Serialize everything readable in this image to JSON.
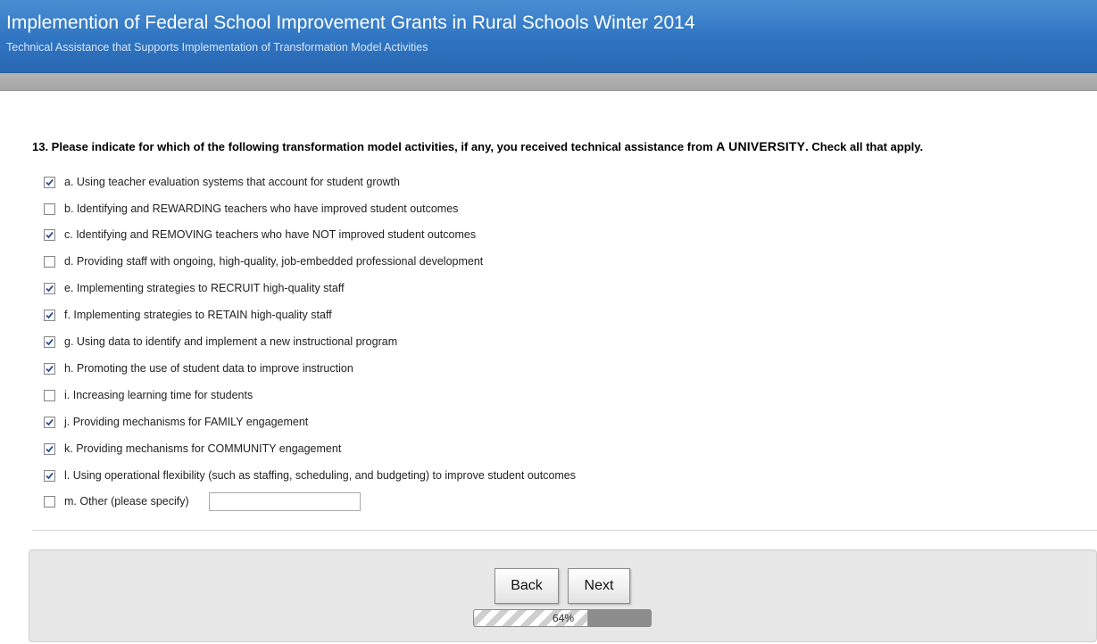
{
  "header": {
    "title": "Implemention of Federal School Improvement Grants in Rural Schools Winter 2014",
    "subtitle": "Technical Assistance that Supports Implementation of Transformation Model Activities"
  },
  "question": {
    "prefix": "13. Please indicate for which of the following transformation model activities, if any, you received technical assistance from ",
    "emphasis": "A UNIVERSITY",
    "suffix": ". Check all that apply."
  },
  "options": [
    {
      "label": "a. Using teacher evaluation systems that account for student growth",
      "checked": true
    },
    {
      "label": "b. Identifying and REWARDING teachers who have improved student outcomes",
      "checked": false
    },
    {
      "label": "c. Identifying and REMOVING teachers who have NOT improved student outcomes",
      "checked": true
    },
    {
      "label": "d. Providing staff with ongoing, high-quality, job-embedded professional development",
      "checked": false
    },
    {
      "label": "e. Implementing strategies to RECRUIT high-quality staff",
      "checked": true
    },
    {
      "label": "f. Implementing strategies to RETAIN high-quality staff",
      "checked": true
    },
    {
      "label": "g. Using data to identify and implement a new instructional program",
      "checked": true
    },
    {
      "label": "h. Promoting the use of student data to improve instruction",
      "checked": true
    },
    {
      "label": "i. Increasing learning time for students",
      "checked": false
    },
    {
      "label": "j. Providing mechanisms for FAMILY engagement",
      "checked": true
    },
    {
      "label": "k. Providing mechanisms for COMMUNITY engagement",
      "checked": true
    },
    {
      "label": "l. Using operational flexibility (such as staffing, scheduling, and budgeting) to improve student outcomes",
      "checked": true
    },
    {
      "label": "m. Other (please specify)",
      "checked": false
    }
  ],
  "other_input": {
    "value": "",
    "placeholder": ""
  },
  "nav": {
    "back_label": "Back",
    "next_label": "Next"
  },
  "progress": {
    "percent": 64,
    "label": "64%"
  },
  "colors": {
    "header_blue": "#2f74c1",
    "check_blue": "#2b4f9c"
  }
}
